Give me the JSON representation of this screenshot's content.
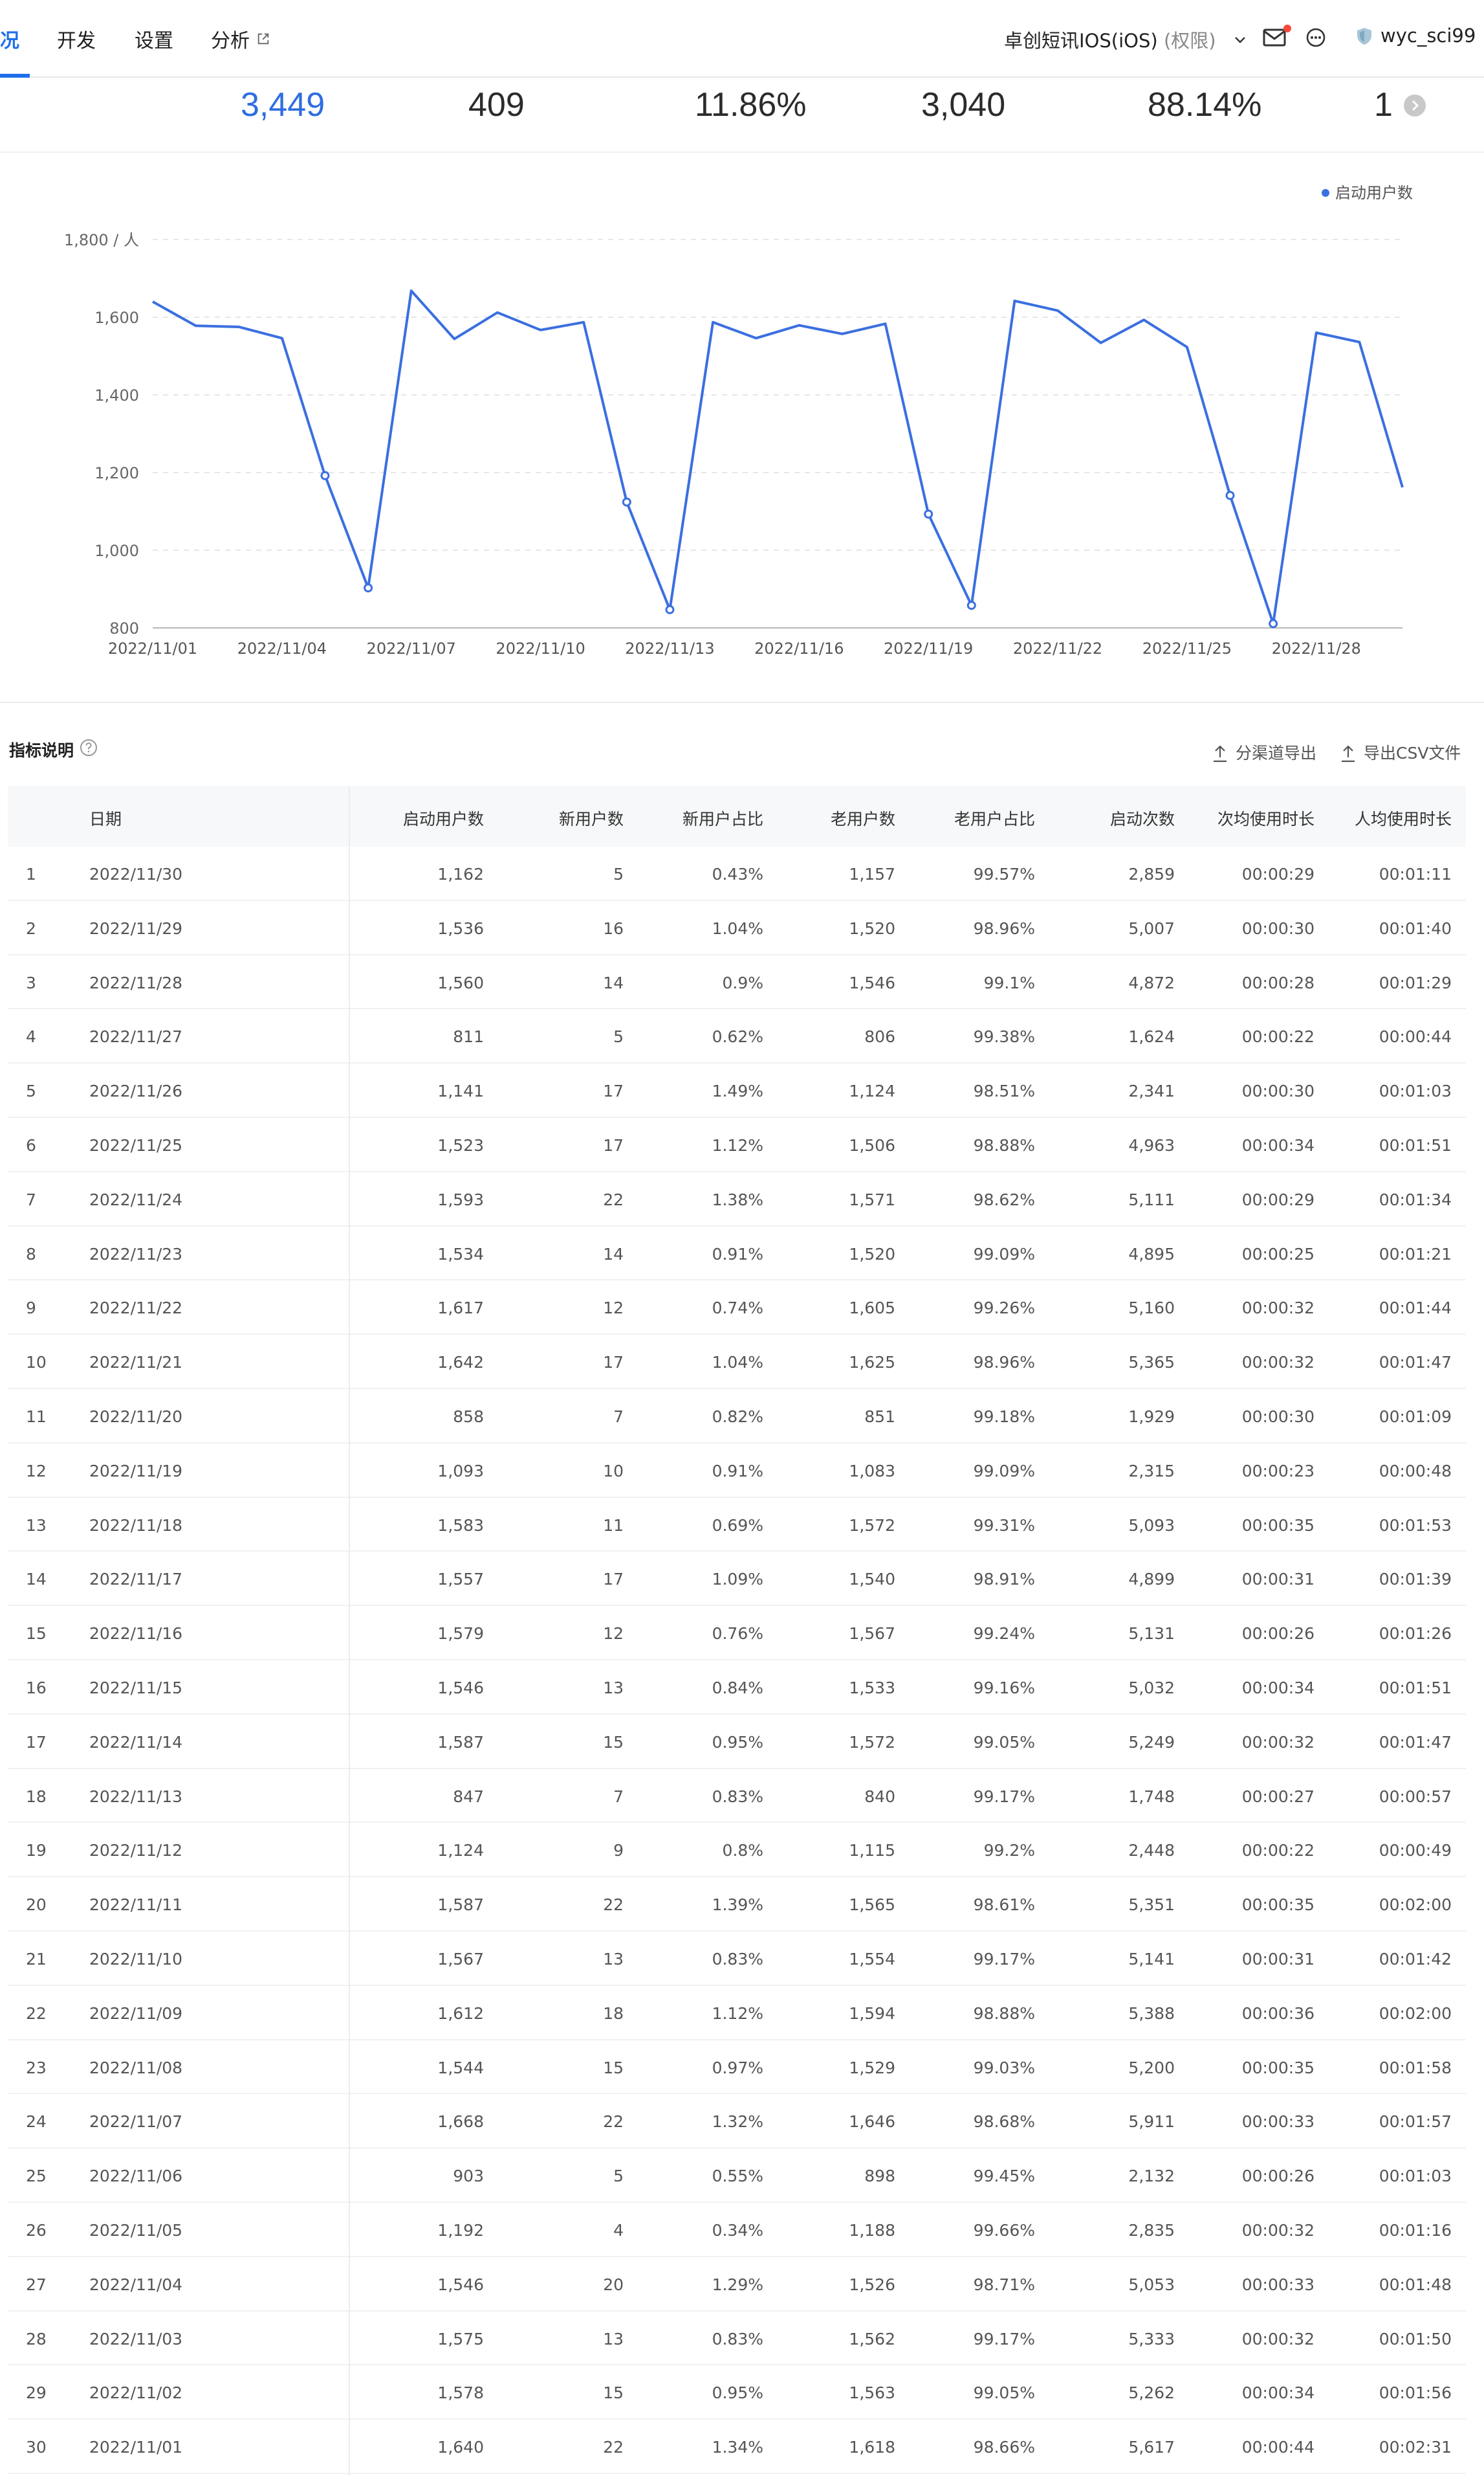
{
  "nav": {
    "active_tab": "况",
    "tabs": [
      "开发",
      "设置",
      "分析"
    ],
    "app_name": "卓创短讯IOS(iOS)",
    "app_perm": "(权限)",
    "username": "wyc_sci99"
  },
  "kpis": [
    "3,449",
    "409",
    "11.86%",
    "3,040",
    "88.14%",
    "1"
  ],
  "chart_data": {
    "type": "line",
    "legend": [
      "启动用户数"
    ],
    "legend_position": "top-right",
    "grid": true,
    "ylim": [
      800,
      1800
    ],
    "y_ticks": [
      "800",
      "1,000",
      "1,200",
      "1,400",
      "1,600",
      "1,800 / 人"
    ],
    "x_tick_labels": [
      "2022/11/01",
      "2022/11/04",
      "2022/11/07",
      "2022/11/10",
      "2022/11/13",
      "2022/11/16",
      "2022/11/19",
      "2022/11/22",
      "2022/11/25",
      "2022/11/28"
    ],
    "x": [
      "2022/11/01",
      "2022/11/02",
      "2022/11/03",
      "2022/11/04",
      "2022/11/05",
      "2022/11/06",
      "2022/11/07",
      "2022/11/08",
      "2022/11/09",
      "2022/11/10",
      "2022/11/11",
      "2022/11/12",
      "2022/11/13",
      "2022/11/14",
      "2022/11/15",
      "2022/11/16",
      "2022/11/17",
      "2022/11/18",
      "2022/11/19",
      "2022/11/20",
      "2022/11/21",
      "2022/11/22",
      "2022/11/23",
      "2022/11/24",
      "2022/11/25",
      "2022/11/26",
      "2022/11/27",
      "2022/11/28",
      "2022/11/29",
      "2022/11/30"
    ],
    "series": [
      {
        "name": "启动用户数",
        "color": "#3b6fe0",
        "values": [
          1640,
          1578,
          1575,
          1546,
          1192,
          903,
          1668,
          1544,
          1612,
          1567,
          1587,
          1124,
          847,
          1587,
          1546,
          1579,
          1557,
          1583,
          1093,
          858,
          1642,
          1617,
          1534,
          1593,
          1523,
          1141,
          811,
          1560,
          1536,
          1162
        ]
      }
    ]
  },
  "section": {
    "title": "指标说明",
    "export_channel": "分渠道导出",
    "export_csv": "导出CSV文件"
  },
  "table": {
    "headers": [
      "日期",
      "启动用户数",
      "新用户数",
      "新用户占比",
      "老用户数",
      "老用户占比",
      "启动次数",
      "次均使用时长",
      "人均使用时长"
    ],
    "rows": [
      [
        "1",
        "2022/11/30",
        "1,162",
        "5",
        "0.43%",
        "1,157",
        "99.57%",
        "2,859",
        "00:00:29",
        "00:01:11"
      ],
      [
        "2",
        "2022/11/29",
        "1,536",
        "16",
        "1.04%",
        "1,520",
        "98.96%",
        "5,007",
        "00:00:30",
        "00:01:40"
      ],
      [
        "3",
        "2022/11/28",
        "1,560",
        "14",
        "0.9%",
        "1,546",
        "99.1%",
        "4,872",
        "00:00:28",
        "00:01:29"
      ],
      [
        "4",
        "2022/11/27",
        "811",
        "5",
        "0.62%",
        "806",
        "99.38%",
        "1,624",
        "00:00:22",
        "00:00:44"
      ],
      [
        "5",
        "2022/11/26",
        "1,141",
        "17",
        "1.49%",
        "1,124",
        "98.51%",
        "2,341",
        "00:00:30",
        "00:01:03"
      ],
      [
        "6",
        "2022/11/25",
        "1,523",
        "17",
        "1.12%",
        "1,506",
        "98.88%",
        "4,963",
        "00:00:34",
        "00:01:51"
      ],
      [
        "7",
        "2022/11/24",
        "1,593",
        "22",
        "1.38%",
        "1,571",
        "98.62%",
        "5,111",
        "00:00:29",
        "00:01:34"
      ],
      [
        "8",
        "2022/11/23",
        "1,534",
        "14",
        "0.91%",
        "1,520",
        "99.09%",
        "4,895",
        "00:00:25",
        "00:01:21"
      ],
      [
        "9",
        "2022/11/22",
        "1,617",
        "12",
        "0.74%",
        "1,605",
        "99.26%",
        "5,160",
        "00:00:32",
        "00:01:44"
      ],
      [
        "10",
        "2022/11/21",
        "1,642",
        "17",
        "1.04%",
        "1,625",
        "98.96%",
        "5,365",
        "00:00:32",
        "00:01:47"
      ],
      [
        "11",
        "2022/11/20",
        "858",
        "7",
        "0.82%",
        "851",
        "99.18%",
        "1,929",
        "00:00:30",
        "00:01:09"
      ],
      [
        "12",
        "2022/11/19",
        "1,093",
        "10",
        "0.91%",
        "1,083",
        "99.09%",
        "2,315",
        "00:00:23",
        "00:00:48"
      ],
      [
        "13",
        "2022/11/18",
        "1,583",
        "11",
        "0.69%",
        "1,572",
        "99.31%",
        "5,093",
        "00:00:35",
        "00:01:53"
      ],
      [
        "14",
        "2022/11/17",
        "1,557",
        "17",
        "1.09%",
        "1,540",
        "98.91%",
        "4,899",
        "00:00:31",
        "00:01:39"
      ],
      [
        "15",
        "2022/11/16",
        "1,579",
        "12",
        "0.76%",
        "1,567",
        "99.24%",
        "5,131",
        "00:00:26",
        "00:01:26"
      ],
      [
        "16",
        "2022/11/15",
        "1,546",
        "13",
        "0.84%",
        "1,533",
        "99.16%",
        "5,032",
        "00:00:34",
        "00:01:51"
      ],
      [
        "17",
        "2022/11/14",
        "1,587",
        "15",
        "0.95%",
        "1,572",
        "99.05%",
        "5,249",
        "00:00:32",
        "00:01:47"
      ],
      [
        "18",
        "2022/11/13",
        "847",
        "7",
        "0.83%",
        "840",
        "99.17%",
        "1,748",
        "00:00:27",
        "00:00:57"
      ],
      [
        "19",
        "2022/11/12",
        "1,124",
        "9",
        "0.8%",
        "1,115",
        "99.2%",
        "2,448",
        "00:00:22",
        "00:00:49"
      ],
      [
        "20",
        "2022/11/11",
        "1,587",
        "22",
        "1.39%",
        "1,565",
        "98.61%",
        "5,351",
        "00:00:35",
        "00:02:00"
      ],
      [
        "21",
        "2022/11/10",
        "1,567",
        "13",
        "0.83%",
        "1,554",
        "99.17%",
        "5,141",
        "00:00:31",
        "00:01:42"
      ],
      [
        "22",
        "2022/11/09",
        "1,612",
        "18",
        "1.12%",
        "1,594",
        "98.88%",
        "5,388",
        "00:00:36",
        "00:02:00"
      ],
      [
        "23",
        "2022/11/08",
        "1,544",
        "15",
        "0.97%",
        "1,529",
        "99.03%",
        "5,200",
        "00:00:35",
        "00:01:58"
      ],
      [
        "24",
        "2022/11/07",
        "1,668",
        "22",
        "1.32%",
        "1,646",
        "98.68%",
        "5,911",
        "00:00:33",
        "00:01:57"
      ],
      [
        "25",
        "2022/11/06",
        "903",
        "5",
        "0.55%",
        "898",
        "99.45%",
        "2,132",
        "00:00:26",
        "00:01:03"
      ],
      [
        "26",
        "2022/11/05",
        "1,192",
        "4",
        "0.34%",
        "1,188",
        "99.66%",
        "2,835",
        "00:00:32",
        "00:01:16"
      ],
      [
        "27",
        "2022/11/04",
        "1,546",
        "20",
        "1.29%",
        "1,526",
        "98.71%",
        "5,053",
        "00:00:33",
        "00:01:48"
      ],
      [
        "28",
        "2022/11/03",
        "1,575",
        "13",
        "0.83%",
        "1,562",
        "99.17%",
        "5,333",
        "00:00:32",
        "00:01:50"
      ],
      [
        "29",
        "2022/11/02",
        "1,578",
        "15",
        "0.95%",
        "1,563",
        "99.05%",
        "5,262",
        "00:00:34",
        "00:01:56"
      ],
      [
        "30",
        "2022/11/01",
        "1,640",
        "22",
        "1.34%",
        "1,618",
        "98.66%",
        "5,617",
        "00:00:44",
        "00:02:31"
      ]
    ]
  }
}
